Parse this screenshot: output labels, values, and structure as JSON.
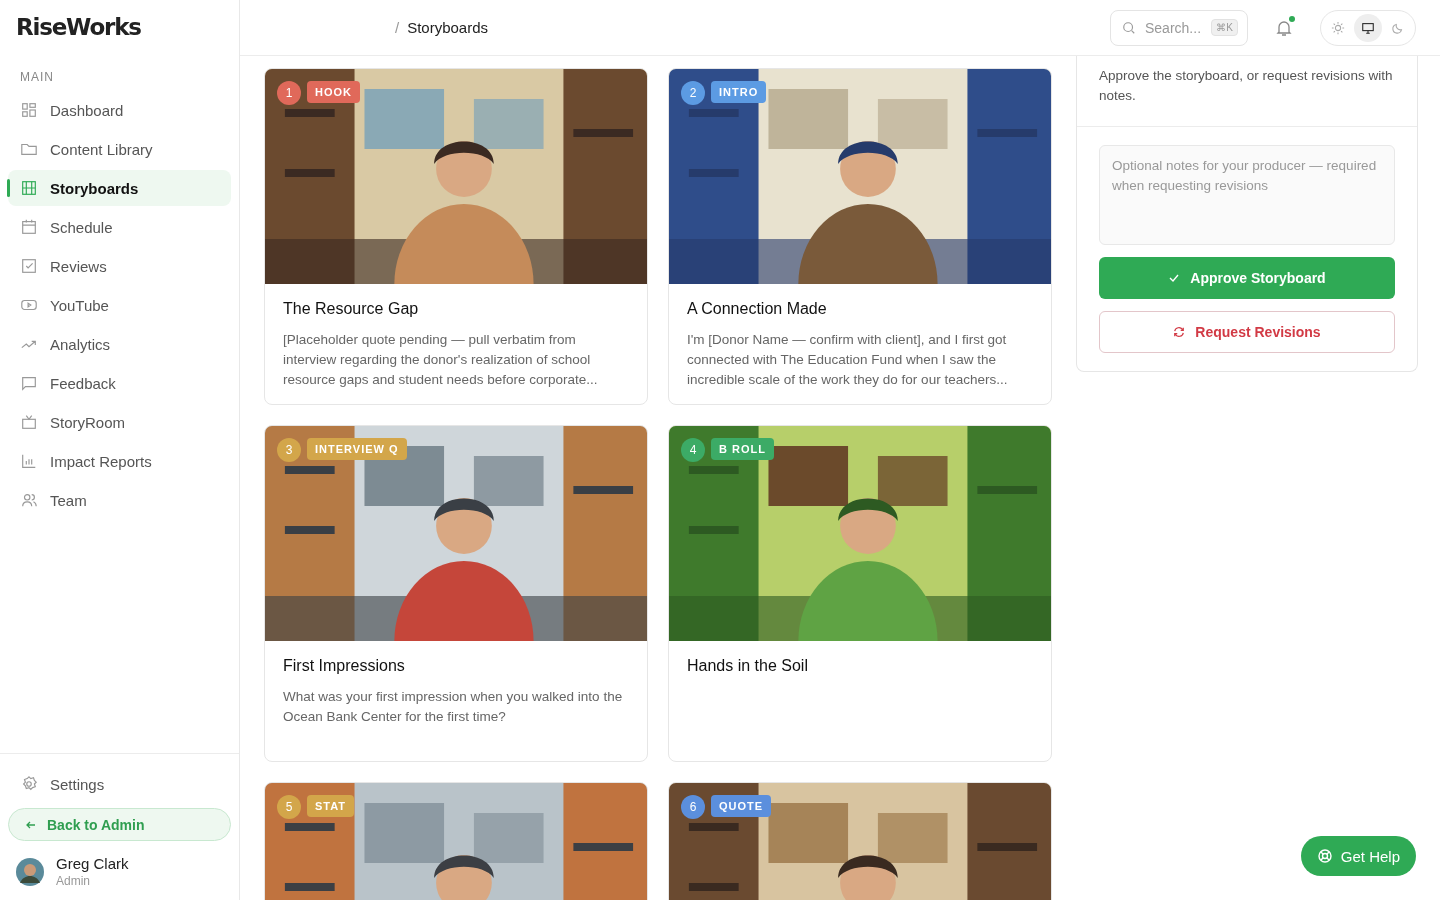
{
  "brand": "RiseWorks",
  "sidebar": {
    "section": "MAIN",
    "items": [
      {
        "label": "Dashboard",
        "selected": false
      },
      {
        "label": "Content Library",
        "selected": false
      },
      {
        "label": "Storyboards",
        "selected": true
      },
      {
        "label": "Schedule",
        "selected": false
      },
      {
        "label": "Reviews",
        "selected": false
      },
      {
        "label": "YouTube",
        "selected": false
      },
      {
        "label": "Analytics",
        "selected": false
      },
      {
        "label": "Feedback",
        "selected": false
      },
      {
        "label": "StoryRoom",
        "selected": false
      },
      {
        "label": "Impact Reports",
        "selected": false
      },
      {
        "label": "Team",
        "selected": false
      }
    ],
    "settings": "Settings",
    "back": "Back to Admin",
    "user": {
      "name": "Greg Clark",
      "role": "Admin"
    }
  },
  "header": {
    "separator": "/",
    "breadcrumb": "Storyboards",
    "search": {
      "placeholder": "Search...",
      "shortcut": "⌘K"
    },
    "notification_dot": true,
    "theme_modes": [
      {
        "selected": false
      },
      {
        "selected": true
      },
      {
        "selected": false
      }
    ]
  },
  "cards": [
    {
      "number": "1",
      "tag": "HOOK",
      "color": "#e0695a",
      "title": "The Resource Gap",
      "text": "[Placeholder quote pending — pull verbatim from interview regarding the donor's realization of school resource gaps and student needs before corporate..."
    },
    {
      "number": "2",
      "tag": "INTRO",
      "color": "#5c9be3",
      "title": "A Connection Made",
      "text": "I'm [Donor Name — confirm with client], and I first got connected with The Education Fund when I saw the incredible scale of the work they do for our teachers..."
    },
    {
      "number": "3",
      "tag": "INTERVIEW Q",
      "color": "#d3a64a",
      "title": "First Impressions",
      "text": "What was your first impression when you walked into the Ocean Bank Center for the first time?"
    },
    {
      "number": "4",
      "tag": "B ROLL",
      "color": "#3cab66",
      "title": "Hands in the Soil"
    },
    {
      "number": "5",
      "tag": "STAT",
      "color": "#d3a64a"
    },
    {
      "number": "6",
      "tag": "QUOTE",
      "color": "#5b8fdd"
    }
  ],
  "review": {
    "intro": "Approve the storyboard, or request revisions with notes.",
    "notes_placeholder": "Optional notes for your producer — required when requesting revisions",
    "approve": "Approve Storyboard",
    "revise": "Request Revisions"
  },
  "help": "Get Help"
}
